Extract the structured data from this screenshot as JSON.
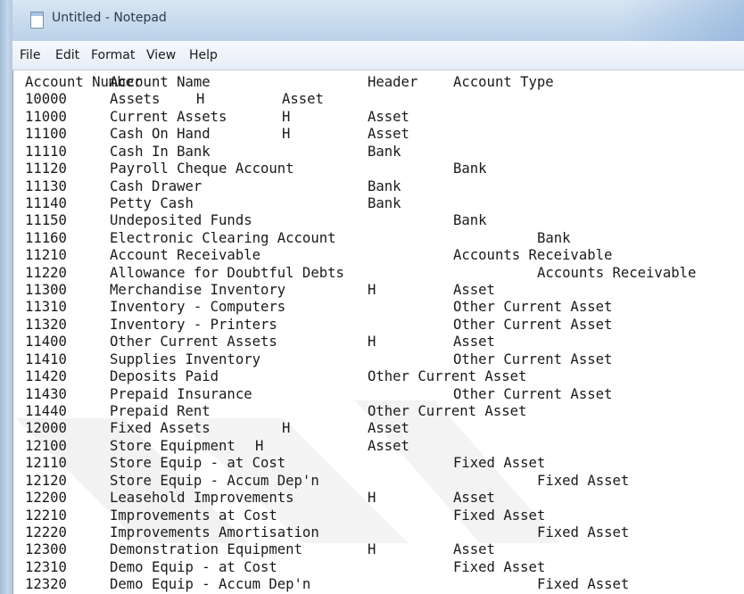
{
  "window": {
    "title": "Untitled - Notepad",
    "icon": "notepad-icon"
  },
  "menu": {
    "items": [
      "File",
      "Edit",
      "Format",
      "View",
      "Help"
    ]
  },
  "document": {
    "rows": [
      [
        "Account Number",
        "Account Name",
        "",
        "Header",
        "Account Type"
      ],
      [
        "10000",
        "Assets",
        "H",
        "Asset",
        ""
      ],
      [
        "11000",
        "Current Assets",
        "H",
        "Asset",
        ""
      ],
      [
        "11100",
        "Cash On Hand",
        "H",
        "Asset",
        ""
      ],
      [
        "11110",
        "Cash In Bank",
        "",
        "Bank",
        ""
      ],
      [
        "11120",
        "Payroll Cheque Account",
        "",
        "Bank",
        ""
      ],
      [
        "11130",
        "Cash Drawer",
        "",
        "Bank",
        ""
      ],
      [
        "11140",
        "Petty Cash",
        "",
        "Bank",
        ""
      ],
      [
        "11150",
        "Undeposited Funds",
        "",
        "Bank",
        ""
      ],
      [
        "11160",
        "Electronic Clearing Account",
        "",
        "Bank",
        ""
      ],
      [
        "11210",
        "Account Receivable",
        "",
        "Accounts Receivable",
        ""
      ],
      [
        "11220",
        "Allowance for Doubtful Debts",
        "",
        "Accounts Receivable",
        ""
      ],
      [
        "11300",
        "Merchandise Inventory",
        "H",
        "Asset",
        ""
      ],
      [
        "11310",
        "Inventory - Computers",
        "",
        "Other Current Asset",
        ""
      ],
      [
        "11320",
        "Inventory - Printers",
        "",
        "Other Current Asset",
        ""
      ],
      [
        "11400",
        "Other Current Assets",
        "H",
        "Asset",
        ""
      ],
      [
        "11410",
        "Supplies Inventory",
        "",
        "Other Current Asset",
        ""
      ],
      [
        "11420",
        "Deposits Paid",
        "",
        "Other Current Asset",
        ""
      ],
      [
        "11430",
        "Prepaid Insurance",
        "",
        "Other Current Asset",
        ""
      ],
      [
        "11440",
        "Prepaid Rent",
        "",
        "Other Current Asset",
        ""
      ],
      [
        "12000",
        "Fixed Assets",
        "H",
        "Asset",
        ""
      ],
      [
        "12100",
        "Store Equipment",
        "H",
        "Asset",
        ""
      ],
      [
        "12110",
        "Store Equip - at Cost",
        "",
        "Fixed Asset",
        ""
      ],
      [
        "12120",
        "Store Equip - Accum Dep'n",
        "",
        "Fixed Asset",
        ""
      ],
      [
        "12200",
        "Leasehold Improvements",
        "H",
        "Asset",
        ""
      ],
      [
        "12210",
        "Improvements at Cost",
        "",
        "Fixed Asset",
        ""
      ],
      [
        "12220",
        "Improvements Amortisation",
        "",
        "Fixed Asset",
        ""
      ],
      [
        "12300",
        "Demonstration Equipment",
        "H",
        "Asset",
        ""
      ],
      [
        "12310",
        "Demo Equip - at Cost",
        "",
        "Fixed Asset",
        ""
      ],
      [
        "12320",
        "Demo Equip - Accum Dep'n",
        "",
        "Fixed Asset",
        ""
      ]
    ]
  },
  "colors": {
    "text": "#1a1a1a",
    "title_text": "#2a3a4c",
    "frame": "#c3d6ea"
  }
}
